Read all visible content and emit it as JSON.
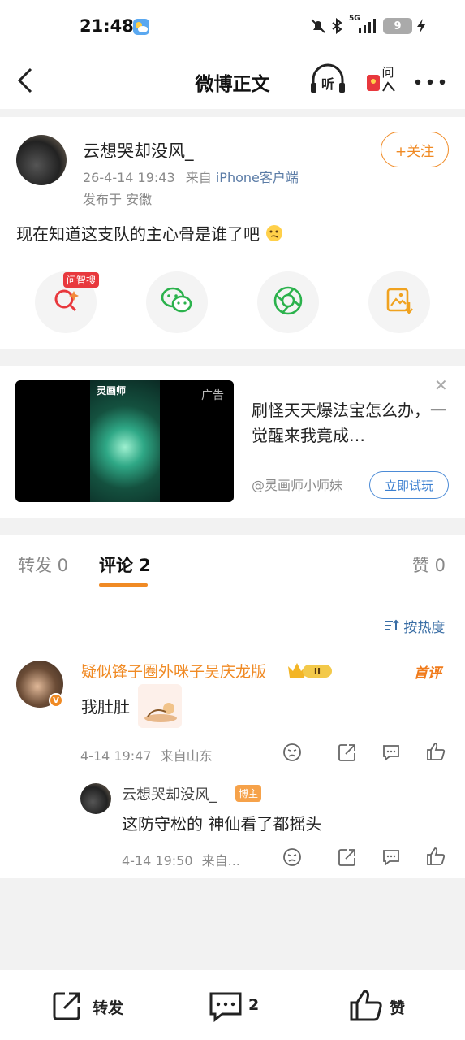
{
  "status_bar": {
    "time": "21:48",
    "network": "5G",
    "battery": "9"
  },
  "nav": {
    "title": "微博正文",
    "listen_label": "听",
    "ask_label": "问"
  },
  "post": {
    "author": "云想哭却没风_",
    "date": "26-4-14 19:43",
    "from_prefix": "来自",
    "source": "iPhone客户端",
    "location": "发布于 安徽",
    "follow_label": "+关注",
    "text": "现在知道这支队的主心骨是谁了吧",
    "ai_search_badge": "问智搜"
  },
  "ad": {
    "tag": "广告",
    "title": "刷怪天天爆法宝怎么办，一觉醒来我竟成…",
    "account": "@灵画师小师妹",
    "cta": "立即试玩",
    "game_title": "灵画师"
  },
  "tabs": {
    "repost": "转发 0",
    "comment": "评论 2",
    "like": "赞 0"
  },
  "comments": {
    "sort_label": "按热度",
    "c1": {
      "name": "疑似锋子圈外咪子吴庆龙版",
      "level": "II",
      "first_tag": "首评",
      "text": "我肚肚",
      "time": "4-14 19:47",
      "from": "来自山东"
    },
    "r1": {
      "name": "云想哭却没风_",
      "badge": "博主",
      "text": "这防守松的 神仙看了都摇头",
      "time": "4-14 19:50",
      "from": "来自..."
    }
  },
  "bottom_bar": {
    "repost_label": "转发",
    "comment_count": "2",
    "like_label": "赞"
  },
  "colors": {
    "accent_orange": "#f08a24",
    "link_blue": "#3b7fd0",
    "badge_red": "#e8383d"
  }
}
